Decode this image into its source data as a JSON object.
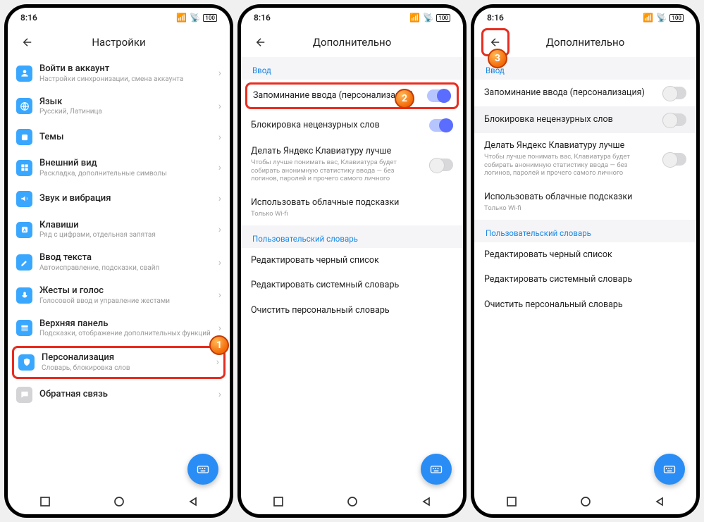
{
  "status": {
    "time": "8:16",
    "battery": "100"
  },
  "screenA": {
    "headerTitle": "Настройки",
    "items": [
      {
        "title": "Войти в аккаунт",
        "sub": "Настройки синхронизации, смена аккаунта",
        "color": "#3aa7ff"
      },
      {
        "title": "Язык",
        "sub": "Русский, Латиница",
        "color": "#3aa7ff"
      },
      {
        "title": "Темы",
        "sub": "",
        "color": "#3aa7ff"
      },
      {
        "title": "Внешний вид",
        "sub": "Раскладка, дополнительные символы",
        "color": "#3aa7ff"
      },
      {
        "title": "Звук и вибрация",
        "sub": "",
        "color": "#3aa7ff"
      },
      {
        "title": "Клавиши",
        "sub": "Ряд с цифрами, отдельная запятая",
        "color": "#3aa7ff"
      },
      {
        "title": "Ввод текста",
        "sub": "Автоисправление, подсказки, свайп",
        "color": "#3aa7ff"
      },
      {
        "title": "Жесты и голос",
        "sub": "Голосовой ввод и управление жестами",
        "color": "#3aa7ff"
      },
      {
        "title": "Верхняя панель",
        "sub": "Подсказки, отображение дополнительных функций",
        "color": "#3aa7ff"
      },
      {
        "title": "Персонализация",
        "sub": "Словарь, блокировка слов",
        "color": "#3aa7ff"
      },
      {
        "title": "Обратная связь",
        "sub": "",
        "color": "#cfcfcf"
      }
    ],
    "markerLabel": "1"
  },
  "screenB": {
    "headerTitle": "Дополнительно",
    "sections": {
      "input": "Ввод",
      "dict": "Пользовательский словарь"
    },
    "items": {
      "mem": {
        "title": "Запоминание ввода (персонализация)",
        "on": true
      },
      "block": {
        "title": "Блокировка нецензурных слов",
        "on": true
      },
      "improve": {
        "title": "Делать Яндекс Клавиатуру лучше",
        "sub": "Чтобы лучше понимать вас, Клавиатура будет собирать анонимную статистику ввода — без логинов, паролей и прочего самого личного",
        "on": false
      },
      "cloud": {
        "title": "Использовать облачные подсказки",
        "sub": "Только Wi-fi"
      },
      "d1": "Редактировать черный список",
      "d2": "Редактировать системный словарь",
      "d3": "Очистить персональный словарь"
    },
    "markerLabel": "2"
  },
  "screenC": {
    "headerTitle": "Дополнительно",
    "sections": {
      "input": "Ввод",
      "dict": "Пользовательский словарь"
    },
    "items": {
      "mem": {
        "title": "Запоминание ввода (персонализация)",
        "on": false
      },
      "block": {
        "title": "Блокировка нецензурных слов",
        "on": false
      },
      "improve": {
        "title": "Делать Яндекс Клавиатуру лучше",
        "sub": "Чтобы лучше понимать вас, Клавиатура будет собирать анонимную статистику ввода — без логинов, паролей и прочего самого личного",
        "on": false
      },
      "cloud": {
        "title": "Использовать облачные подсказки",
        "sub": "Только Wi-fi"
      },
      "d1": "Редактировать черный список",
      "d2": "Редактировать системный словарь",
      "d3": "Очистить персональный словарь"
    },
    "markerLabel": "3"
  }
}
